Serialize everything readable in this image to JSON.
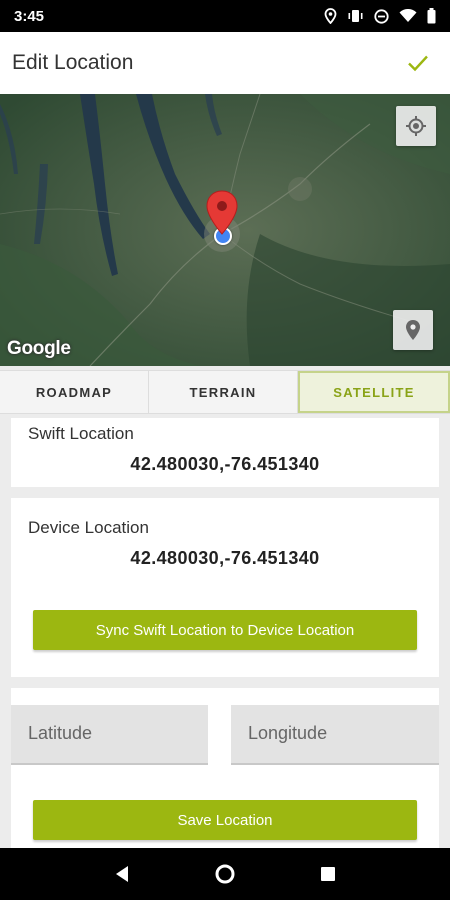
{
  "status_bar": {
    "time": "3:45",
    "icons": [
      "location-icon",
      "vibrate-icon",
      "do-not-disturb-icon",
      "wifi-icon",
      "battery-icon"
    ]
  },
  "app_bar": {
    "title": "Edit Location",
    "confirm_icon": "check-icon"
  },
  "map": {
    "attribution": "Google",
    "controls": [
      "my-location-icon",
      "place-marker-icon"
    ]
  },
  "map_type_tabs": [
    {
      "label": "ROADMAP",
      "active": false
    },
    {
      "label": "TERRAIN",
      "active": false
    },
    {
      "label": "SATELLITE",
      "active": true
    }
  ],
  "swift_location": {
    "label": "Swift Location",
    "value": "42.480030,-76.451340"
  },
  "device_location": {
    "label": "Device Location",
    "value": "42.480030,-76.451340",
    "sync_button": "Sync Swift Location to Device Location"
  },
  "manual_entry": {
    "latitude_placeholder": "Latitude",
    "longitude_placeholder": "Longitude",
    "save_button": "Save Location"
  },
  "colors": {
    "accent": "#9cb711",
    "active_tab_text": "#8aa317",
    "pin": "#e53935",
    "device_dot": "#4285f4"
  }
}
